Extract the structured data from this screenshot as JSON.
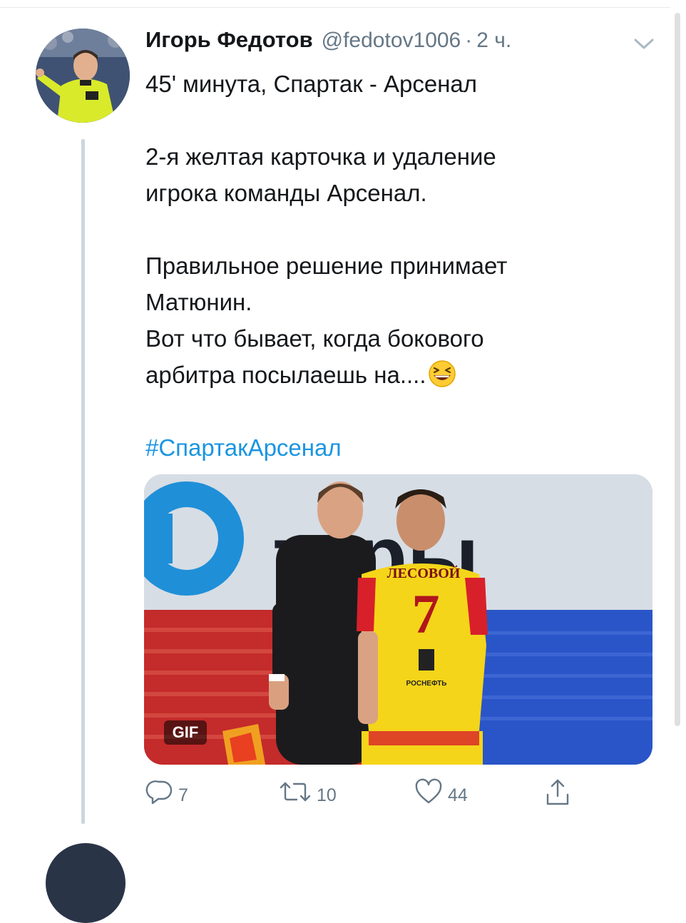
{
  "tweet": {
    "display_name": "Игорь Федотов",
    "handle": "@fedotov1006",
    "separator": "·",
    "time": "2 ч.",
    "text_lines": [
      "45' минута, Спартак - Арсенал",
      "",
      "2-я желтая карточка и удаление",
      "игрока команды Арсенал.",
      "",
      "Правильное решение принимает",
      "Матюнин.",
      "Вот что бывает, когда бокового",
      "арбитра посылаешь на...."
    ],
    "hashtag": "#СпартакАрсенал"
  },
  "media": {
    "badge": "GIF",
    "banner_text": "ткры",
    "player_name": "ЛЕСОВОЙ",
    "player_number": "7",
    "sponsor": "РОСНЕФТЬ"
  },
  "actions": {
    "reply_count": "7",
    "retweet_count": "10",
    "like_count": "44"
  },
  "icons": {
    "caret": "chevron-down-icon",
    "reply": "reply-icon",
    "retweet": "retweet-icon",
    "like": "heart-icon",
    "share": "share-icon",
    "emoji": "grinning-squinting-face-icon"
  },
  "colors": {
    "text": "#14171a",
    "secondary": "#657786",
    "link": "#1b95e0",
    "thread_line": "#ccd6dd"
  }
}
